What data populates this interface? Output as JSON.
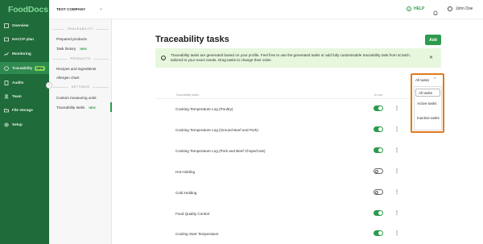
{
  "app": {
    "logo": "FoodDocs",
    "company": "TEST COMPANY",
    "help": "HELP",
    "user": "John Doe"
  },
  "nav": [
    {
      "label": "Overview",
      "icon": "overview-icon"
    },
    {
      "label": "HACCP plan",
      "icon": "haccp-icon"
    },
    {
      "label": "Monitoring",
      "icon": "monitoring-icon"
    },
    {
      "label": "Traceability",
      "icon": "traceability-icon",
      "badge": "NEW",
      "active": true
    },
    {
      "label": "Audits",
      "icon": "audits-icon"
    },
    {
      "label": "Team",
      "icon": "team-icon"
    },
    {
      "label": "File storage",
      "icon": "file-storage-icon"
    },
    {
      "label": "Setup",
      "icon": "gear-icon"
    }
  ],
  "subnav": {
    "sections": [
      "TRACEABILITY",
      "PRODUCTS",
      "SETTINGS"
    ],
    "items": [
      {
        "label": "Prepared products"
      },
      {
        "label": "Task history",
        "badge": "NEW"
      },
      {
        "label": "Recipes and ingredients"
      },
      {
        "label": "Allergen chart"
      },
      {
        "label": "Custom measuring units"
      },
      {
        "label": "Traceability tasks",
        "badge": "NEW",
        "active": true
      }
    ]
  },
  "page": {
    "title": "Traceability tasks",
    "add_label": "Add",
    "banner": "Traceability tasks are generated based on your profile. Feel free to use the generated tasks or add fully customisable traceability task from scratch, tailored to your exact needs. Drag tasks to change their order.",
    "columns": {
      "name": "Traceability tasks",
      "in_use": "In use"
    }
  },
  "tasks": [
    {
      "name": "Cooking Temperature Log (Poultry)",
      "in_use": true
    },
    {
      "name": "Cooking Temperature Log (Ground Beef and Pork)",
      "in_use": true
    },
    {
      "name": "Cooking Temperature Log (Pork and Beef Chops/Cuts)",
      "in_use": true
    },
    {
      "name": "Hot Holding",
      "in_use": false
    },
    {
      "name": "Cold Holding",
      "in_use": false
    },
    {
      "name": "Food Quality Control",
      "in_use": true
    },
    {
      "name": "Cooling Start Temperature",
      "in_use": true
    }
  ],
  "filter": {
    "selected": "All tasks",
    "options": [
      "All tasks",
      "Active tasks",
      "Inactive tasks"
    ]
  },
  "colors": {
    "brand_dark": "#1f6b39",
    "accent": "#2d9a4d",
    "highlight": "#e07a1f"
  }
}
